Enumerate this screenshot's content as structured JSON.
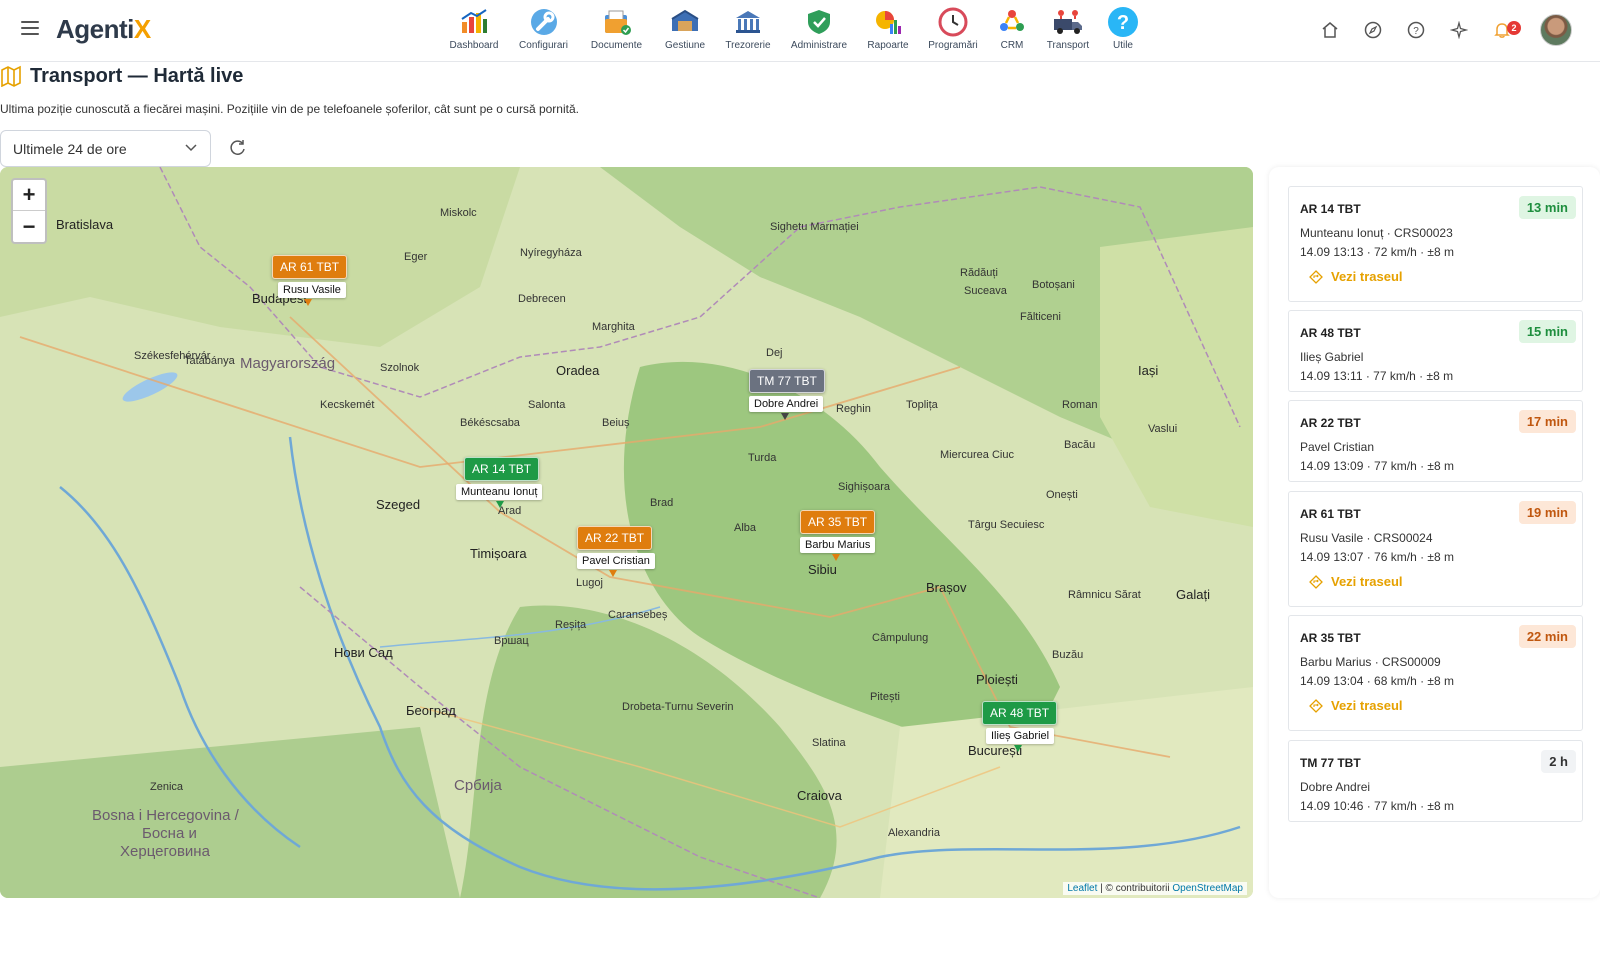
{
  "app": {
    "brand_main": "Agenti",
    "brand_x": "X"
  },
  "modules": [
    {
      "label": "Dashboard",
      "icon": "dashboard-icon"
    },
    {
      "label": "Configurari",
      "icon": "wrench-icon"
    },
    {
      "label": "Documente",
      "icon": "documents-icon"
    },
    {
      "label": "Gestiune",
      "icon": "warehouse-icon"
    },
    {
      "label": "Trezorerie",
      "icon": "bank-icon"
    },
    {
      "label": "Administrare",
      "icon": "shield-icon"
    },
    {
      "label": "Rapoarte",
      "icon": "reports-icon"
    },
    {
      "label": "Programări",
      "icon": "clock-icon"
    },
    {
      "label": "CRM",
      "icon": "crm-icon"
    },
    {
      "label": "Transport",
      "icon": "truck-icon"
    },
    {
      "label": "Utile",
      "icon": "help-icon"
    }
  ],
  "notifications": {
    "count": "2"
  },
  "page": {
    "title": "Transport — Hartă live",
    "subtitle": "Ultima poziție cunoscută a fiecărei mașini. Pozițiile vin de pe telefoanele șoferilor, cât sunt pe o cursă pornită.",
    "range_value": "Ultimele 24 de ore"
  },
  "map": {
    "zoom_in": "+",
    "zoom_out": "−",
    "attribution_leaflet": "Leaflet",
    "attribution_mid": " | © contribuitorii ",
    "attribution_osm": "OpenStreetMap",
    "labels": {
      "bratislava": "Bratislava",
      "budapest": "Budapest",
      "magyarorszag": "Magyarország",
      "miskolc": "Miskolc",
      "debrecen": "Debrecen",
      "nyiregyhaza": "Nyíregyháza",
      "oradea": "Oradea",
      "kecskemet": "Kecskemét",
      "szeged": "Szeged",
      "arad": "Arad",
      "timisoara": "Timișoara",
      "beograd": "Београд",
      "novisad": "Нови Сад",
      "srbija": "Србија",
      "bosna": "Bosna i Hercegovina /",
      "bosna2": "Босна и",
      "bosna3": "Херцеговина",
      "cluj": "Dej",
      "brasov": "Brașov",
      "sibiu": "Sibiu",
      "ploiesti": "Ploiești",
      "bucuresti": "București",
      "iasi": "Iași",
      "galati": "Galați",
      "suceava": "Suceava",
      "bacau": "Bacău",
      "craiova": "Craiova",
      "pitesti": "Pitești",
      "sighetu": "Sighetu Marmației",
      "targu": "Târgu Secuiesc",
      "resita": "Reșița",
      "caransebes": "Caransebeș",
      "lugoj": "Lugoj",
      "deva": "Brad",
      "alba": "Alba",
      "salonta": "Salonta",
      "bekescsaba": "Békéscsaba",
      "eger": "Eger",
      "szolnok": "Szolnok",
      "tatabanya": "Tatabánya",
      "szekesfehervar": "Székesfehérvár",
      "zenica": "Zenica",
      "vrsac": "Вршац",
      "drobeta": "Drobeta-Turnu Severin",
      "alexandria": "Alexandria",
      "slatina": "Slatina",
      "campulung": "Câmpulung",
      "buzau": "Buzău",
      "focsani": "Râmnicu Sărat",
      "vaslui": "Vaslui",
      "roman": "Roman",
      "onesti": "Onești",
      "botosani": "Botoșani",
      "radauti": "Rădăuți",
      "falticeni": "Fălticeni",
      "toplita": "Toplița",
      "reghin": "Reghin",
      "turda": "Turda",
      "sighisoara": "Sighișoara",
      "miercurea": "Miercurea Ciuc",
      "marghita": "Marghita",
      "beius": "Beiuș"
    }
  },
  "vehicles": [
    {
      "plate": "AR 14 TBT",
      "driver": "Munteanu Ionuț",
      "course": "CRS00023",
      "line1": "Munteanu Ionuț · CRS00023",
      "line2": "14.09 13:13 · 72 km/h · ±8 m",
      "age": "13 min",
      "age_color": "green",
      "route": "Vezi traseul",
      "marker_color": "#1e9a46"
    },
    {
      "plate": "AR 48 TBT",
      "driver": "Ilieș Gabriel",
      "line1": "Ilieș Gabriel",
      "line2": "14.09 13:11 · 77 km/h · ±8 m",
      "age": "15 min",
      "age_color": "green",
      "marker_color": "#1e9a46"
    },
    {
      "plate": "AR 22 TBT",
      "driver": "Pavel Cristian",
      "line1": "Pavel Cristian",
      "line2": "14.09 13:09 · 77 km/h · ±8 m",
      "age": "17 min",
      "age_color": "orange",
      "marker_color": "#df7d0e"
    },
    {
      "plate": "AR 61 TBT",
      "driver": "Rusu Vasile",
      "line1": "Rusu Vasile · CRS00024",
      "line2": "14.09 13:07 · 76 km/h · ±8 m",
      "age": "19 min",
      "age_color": "orange",
      "route": "Vezi traseul",
      "marker_color": "#df7d0e"
    },
    {
      "plate": "AR 35 TBT",
      "driver": "Barbu Marius",
      "line1": "Barbu Marius · CRS00009",
      "line2": "14.09 13:04 · 68 km/h · ±8 m",
      "age": "22 min",
      "age_color": "orange",
      "route": "Vezi traseul",
      "marker_color": "#df7d0e"
    },
    {
      "plate": "TM 77 TBT",
      "driver": "Dobre Andrei",
      "line1": "Dobre Andrei",
      "line2": "14.09 10:46 · 77 km/h · ±8 m",
      "age": "2 h",
      "age_color": "gray",
      "marker_color": "#6b7280"
    }
  ]
}
